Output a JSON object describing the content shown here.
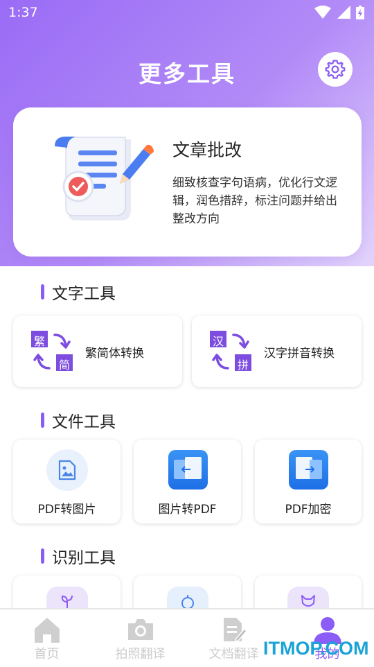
{
  "status_bar": {
    "time": "1:37"
  },
  "header": {
    "title": "更多工具"
  },
  "feature": {
    "title": "文章批改",
    "description": "细致核查字句语病，优化行文逻辑，润色措辞，标注问题并给出整改方向"
  },
  "sections": {
    "text_tools": {
      "title": "文字工具",
      "items": [
        {
          "label": "繁简体转换",
          "icon_chars": [
            "繁",
            "简"
          ]
        },
        {
          "label": "汉字拼音转换",
          "icon_chars": [
            "汉",
            "拼"
          ]
        }
      ]
    },
    "file_tools": {
      "title": "文件工具",
      "items": [
        {
          "label": "PDF转图片"
        },
        {
          "label": "图片转PDF"
        },
        {
          "label": "PDF加密"
        }
      ]
    },
    "ocr_tools": {
      "title": "识别工具"
    }
  },
  "tabs": [
    {
      "label": "首页"
    },
    {
      "label": "拍照翻译"
    },
    {
      "label": "文档翻译"
    },
    {
      "label": "我的"
    }
  ],
  "watermark": "ITMOP.COM",
  "colors": {
    "accent": "#8b5cf6",
    "header_gradient_start": "#9a6bf5",
    "blue_icon": "#2f7ff0"
  }
}
